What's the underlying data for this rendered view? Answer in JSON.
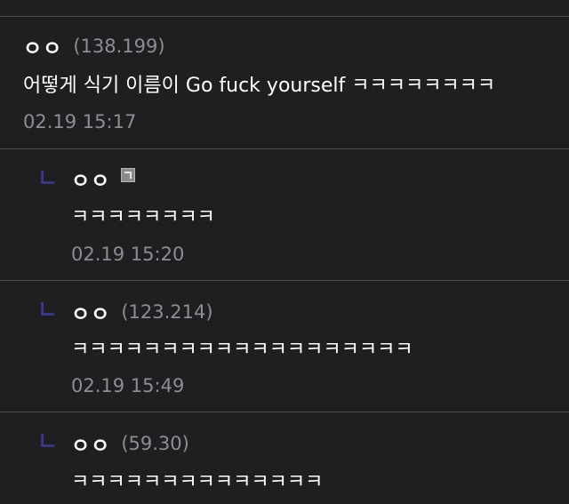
{
  "comments": [
    {
      "nickname": "ㅇㅇ",
      "ip": "(138.199)",
      "text": "어떻게 식기 이름이 Go fuck yourself ㅋㅋㅋㅋㅋㅋㅋㅋ",
      "date": "02.19 15:17"
    }
  ],
  "replies": [
    {
      "nickname": "ㅇㅇ",
      "icon": "user-badge-icon",
      "text": "ㅋㅋㅋㅋㅋㅋㅋㅋ",
      "date": "02.19 15:20"
    },
    {
      "nickname": "ㅇㅇ",
      "ip": "(123.214)",
      "text": "ㅋㅋㅋㅋㅋㅋㅋㅋㅋㅋㅋㅋㅋㅋㅋㅋㅋㅋㅋ",
      "date": "02.19 15:49"
    },
    {
      "nickname": "ㅇㅇ",
      "ip": "(59.30)",
      "text": "ㅋㅋㅋㅋㅋㅋㅋㅋㅋㅋㅋㅋㅋㅋ"
    }
  ]
}
